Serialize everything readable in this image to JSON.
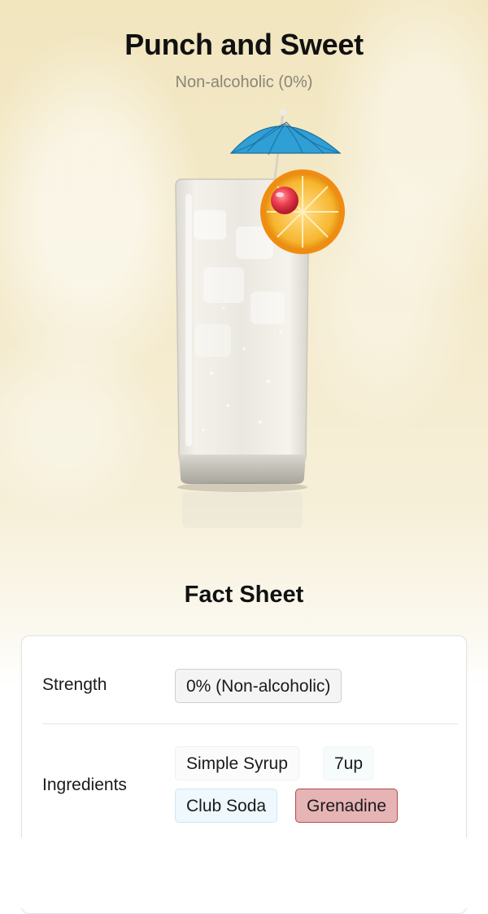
{
  "drink": {
    "name": "Punch and Sweet",
    "strength_subtitle": "Non-alcoholic (0%)"
  },
  "fact_sheet": {
    "title": "Fact Sheet",
    "strength": {
      "label": "Strength",
      "value": "0% (Non-alcoholic)"
    },
    "ingredients": {
      "label": "Ingredients",
      "items": [
        "Simple Syrup",
        "7up",
        "Club Soda",
        "Grenadine"
      ]
    }
  },
  "colors": {
    "background_top": "#f2e6bf",
    "grenadine_chip": "#e6b4b4",
    "grenadine_border": "#b94a4a",
    "club_soda_chip": "#eef8fd",
    "umbrella": "#2f9fd6",
    "orange": "#f5a623",
    "cherry": "#e8374a"
  },
  "icons": [
    "cocktail-glass-illustration",
    "paper-umbrella-icon",
    "orange-slice-icon",
    "cherry-icon"
  ]
}
